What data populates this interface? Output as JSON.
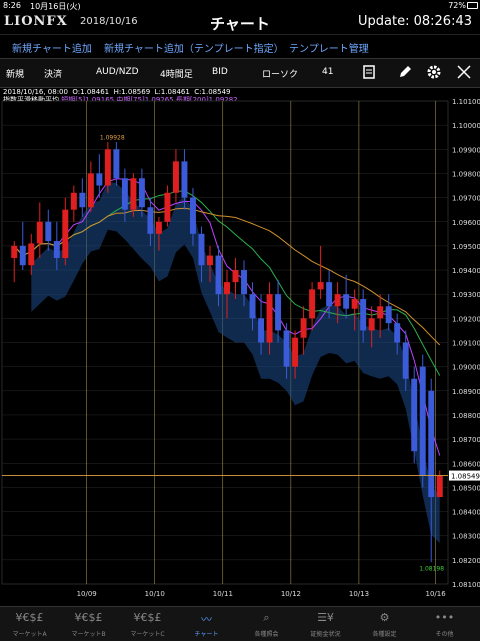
{
  "status": {
    "time": "8:26",
    "date": "10月16日(火)",
    "battery": "72%"
  },
  "header": {
    "logo": "LIONFX",
    "date": "2018/10/16",
    "title": "チャート",
    "update": "Update: 08:26:43"
  },
  "menu": [
    "新規チャート追加",
    "新規チャート追加（テンプレート指定）",
    "テンプレート管理"
  ],
  "toolbar": {
    "mode": "新規",
    "settle": "決済",
    "pair": "AUD/NZD",
    "period": "4時間足",
    "side": "BID",
    "chart_type": "ローソク",
    "count": "41"
  },
  "ohlc": {
    "datetime": "2018/10/16, 08:00",
    "o": "O:1.08461",
    "h": "H:1.08569",
    "l": "L:1.08461",
    "c": "C:1.08549"
  },
  "indicators": [
    {
      "name": "指数平滑移動平均",
      "params": "短期[5]1.09165 中期[75]1.09265 長期[200]1.09282"
    },
    {
      "name": "パラボリック",
      "params": "買:----- 売:1.09045"
    },
    {
      "name": "スパンモデル",
      "params": "スパンA[9]1.08963 スパンB[52]1.09068 遅行線[26]----"
    }
  ],
  "colors": {
    "up": "#e02020",
    "down": "#3b5bd9",
    "cloud": "#1c4d8c",
    "grid": "#2a2a2a"
  },
  "chart_data": {
    "type": "candlestick",
    "ylim": [
      1.081,
      1.101
    ],
    "yticks": [
      "1.10100",
      "1.10000",
      "1.09900",
      "1.09800",
      "1.09700",
      "1.09600",
      "1.09500",
      "1.09400",
      "1.09300",
      "1.09200",
      "1.09100",
      "1.09000",
      "1.08900",
      "1.08800",
      "1.08700",
      "1.08600",
      "1.08500",
      "1.08400",
      "1.08300",
      "1.08200",
      "1.08100"
    ],
    "xlabels": [
      {
        "label": "10/09",
        "i": 9
      },
      {
        "label": "10/10",
        "i": 17
      },
      {
        "label": "10/11",
        "i": 25
      },
      {
        "label": "10/12",
        "i": 33
      },
      {
        "label": "10/13",
        "i": 41
      },
      {
        "label": "10/16",
        "i": 50
      }
    ],
    "current_price": "1.08549",
    "high_label": "1.09928",
    "low_label": "1.08198",
    "candles": [
      [
        1.0945,
        1.0952,
        1.0935,
        1.095
      ],
      [
        1.095,
        1.096,
        1.094,
        1.0942
      ],
      [
        1.0942,
        1.0955,
        1.0938,
        1.0951
      ],
      [
        1.0951,
        1.0968,
        1.0945,
        1.096
      ],
      [
        1.096,
        1.0965,
        1.0948,
        1.0952
      ],
      [
        1.0952,
        1.096,
        1.094,
        1.0945
      ],
      [
        1.0945,
        1.097,
        1.0942,
        1.0965
      ],
      [
        1.0965,
        1.0975,
        1.096,
        1.0972
      ],
      [
        1.0972,
        1.0978,
        1.0962,
        1.0966
      ],
      [
        1.0966,
        1.0985,
        1.0964,
        1.098
      ],
      [
        1.098,
        1.0988,
        1.097,
        1.0975
      ],
      [
        1.0975,
        1.0993,
        1.0972,
        1.099
      ],
      [
        1.099,
        1.0993,
        1.0975,
        1.0978
      ],
      [
        1.0978,
        1.0982,
        1.096,
        1.0965
      ],
      [
        1.0965,
        1.098,
        1.0962,
        1.0978
      ],
      [
        1.0978,
        1.0982,
        1.0962,
        1.0966
      ],
      [
        1.0966,
        1.097,
        1.095,
        1.0955
      ],
      [
        1.0955,
        1.0962,
        1.0948,
        1.096
      ],
      [
        1.096,
        1.0975,
        1.0958,
        1.0972
      ],
      [
        1.0972,
        1.099,
        1.0968,
        1.0985
      ],
      [
        1.0985,
        1.099,
        1.0965,
        1.097
      ],
      [
        1.097,
        1.0974,
        1.095,
        1.0955
      ],
      [
        1.0955,
        1.0958,
        1.0935,
        1.0942
      ],
      [
        1.0942,
        1.095,
        1.0935,
        1.0946
      ],
      [
        1.0946,
        1.095,
        1.0925,
        1.093
      ],
      [
        1.093,
        1.094,
        1.092,
        1.0935
      ],
      [
        1.0935,
        1.0945,
        1.0928,
        1.094
      ],
      [
        1.094,
        1.0944,
        1.0925,
        1.093
      ],
      [
        1.093,
        1.0935,
        1.0915,
        1.092
      ],
      [
        1.092,
        1.093,
        1.0905,
        1.091
      ],
      [
        1.091,
        1.0935,
        1.0905,
        1.093
      ],
      [
        1.093,
        1.0936,
        1.091,
        1.0915
      ],
      [
        1.0915,
        1.0918,
        1.0895,
        1.09
      ],
      [
        1.09,
        1.0915,
        1.0895,
        1.0912
      ],
      [
        1.0912,
        1.0925,
        1.0905,
        1.092
      ],
      [
        1.092,
        1.0935,
        1.0915,
        1.0932
      ],
      [
        1.0932,
        1.095,
        1.0928,
        1.0935
      ],
      [
        1.0935,
        1.094,
        1.092,
        1.0925
      ],
      [
        1.0925,
        1.0935,
        1.0918,
        1.093
      ],
      [
        1.093,
        1.0938,
        1.092,
        1.0924
      ],
      [
        1.0924,
        1.0932,
        1.0915,
        1.0928
      ],
      [
        1.0928,
        1.0932,
        1.091,
        1.0915
      ],
      [
        1.0915,
        1.0925,
        1.0908,
        1.092
      ],
      [
        1.092,
        1.093,
        1.0912,
        1.0925
      ],
      [
        1.0925,
        1.093,
        1.0915,
        1.0918
      ],
      [
        1.0918,
        1.0922,
        1.0905,
        1.091
      ],
      [
        1.091,
        1.0915,
        1.089,
        1.0895
      ],
      [
        1.0895,
        1.09,
        1.086,
        1.0865
      ],
      [
        1.09,
        1.0905,
        1.085,
        1.0855
      ],
      [
        1.089,
        1.0895,
        1.0819,
        1.0846
      ],
      [
        1.0846,
        1.0857,
        1.0846,
        1.0855
      ]
    ]
  },
  "tabs": [
    {
      "icon": "¥€$£",
      "label": "マーケットA"
    },
    {
      "icon": "¥€$£",
      "label": "マーケットB"
    },
    {
      "icon": "¥€$£",
      "label": "マーケットC"
    },
    {
      "icon": "〰",
      "label": "チャート"
    },
    {
      "icon": "⌕",
      "label": "各種照会"
    },
    {
      "icon": "☰¥",
      "label": "証拠金状況"
    },
    {
      "icon": "⚙",
      "label": "各種設定"
    },
    {
      "icon": "•••",
      "label": "その他"
    }
  ]
}
